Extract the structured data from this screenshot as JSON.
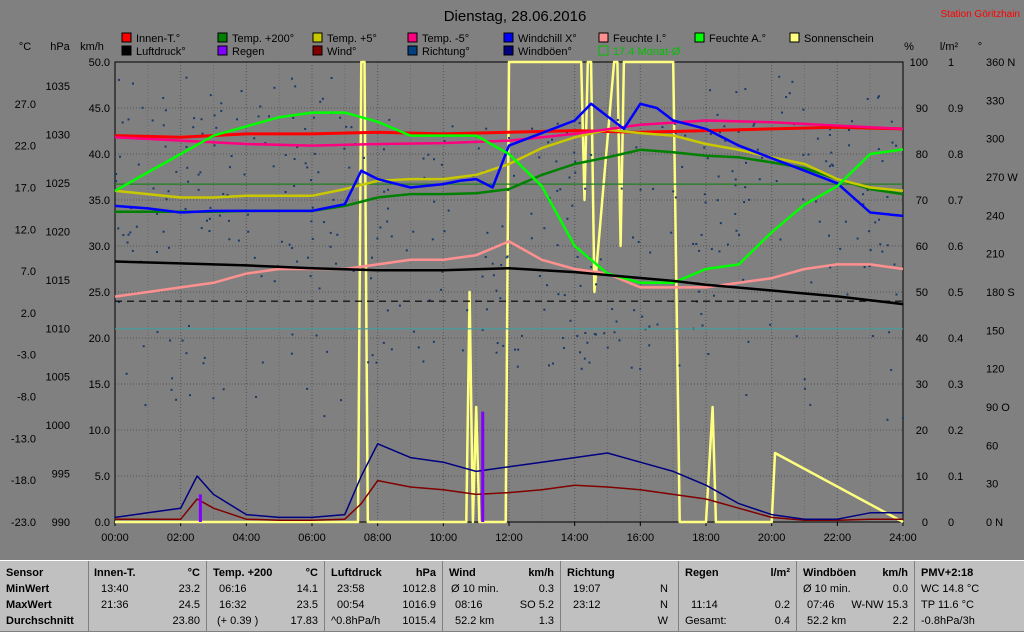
{
  "chart_data": {
    "type": "line",
    "title": "Dienstag, 28.06.2016",
    "station": "Station Göritzhain",
    "units_left": [
      "°C",
      "hPa",
      "km/h"
    ],
    "units_right": [
      "%",
      "l/m²",
      "°"
    ],
    "x_ticks": [
      "00:00",
      "02:00",
      "04:00",
      "06:00",
      "08:00",
      "10:00",
      "12:00",
      "14:00",
      "16:00",
      "18:00",
      "20:00",
      "22:00",
      "24:00"
    ],
    "y_temp_ticks": [
      "27.0",
      "22.0",
      "17.0",
      "12.0",
      "7.0",
      "2.0",
      "-3.0",
      "-8.0",
      "-13.0",
      "-18.0",
      "-23.0"
    ],
    "y_pressure_ticks": [
      "1035",
      "1030",
      "1025",
      "1020",
      "1015",
      "1010",
      "1005",
      "1000",
      "995",
      "990"
    ],
    "y_wind_ticks": [
      "50.0",
      "45.0",
      "40.0",
      "35.0",
      "30.0",
      "25.0",
      "20.0",
      "15.0",
      "10.0",
      "5.0",
      "0.0"
    ],
    "y_humidity_ticks": [
      "100",
      "90",
      "80",
      "70",
      "60",
      "50",
      "40",
      "30",
      "20",
      "10",
      "0"
    ],
    "y_rain_ticks": [
      "1",
      "0.9",
      "0.8",
      "0.7",
      "0.6",
      "0.5",
      "0.4",
      "0.3",
      "0.2",
      "0.1",
      "0"
    ],
    "y_dir_ticks": [
      "360 N",
      "330",
      "300",
      "270 W",
      "240",
      "210",
      "180 S",
      "150",
      "120",
      "90 O",
      "60",
      "30",
      "0 N"
    ],
    "legend": [
      {
        "label": "Innen-T.°",
        "color": "#ff0000"
      },
      {
        "label": "Temp. +200°",
        "color": "#008000"
      },
      {
        "label": "Temp. +5°",
        "color": "#c8c800"
      },
      {
        "label": "Temp. -5°",
        "color": "#ff0080"
      },
      {
        "label": "Windchill X°",
        "color": "#0000ff"
      },
      {
        "label": "Feuchte I.°",
        "color": "#ff9090"
      },
      {
        "label": "Feuchte A.°",
        "color": "#00ff00"
      },
      {
        "label": "Sonnenschein",
        "color": "#ffff80"
      },
      {
        "label": "Luftdruck°",
        "color": "#000000"
      },
      {
        "label": "Regen",
        "color": "#8000ff"
      },
      {
        "label": "Wind°",
        "color": "#800000"
      },
      {
        "label": "Richtung°",
        "color": "#004080"
      },
      {
        "label": "Windböen°",
        "color": "#000080"
      },
      {
        "label": "17.4 Monat-Ø",
        "color": "#00c000"
      }
    ],
    "series": [
      {
        "name": "Innen-T.°",
        "axis": "temp",
        "x": [
          0,
          2,
          4,
          6,
          8,
          10,
          12,
          14,
          16,
          18,
          20,
          22,
          24
        ],
        "values": [
          23.2,
          23.0,
          23.4,
          23.4,
          23.6,
          23.4,
          23.6,
          23.8,
          23.6,
          23.8,
          24.0,
          24.2,
          24.0
        ]
      },
      {
        "name": "Temp. +200°",
        "axis": "temp",
        "x": [
          0,
          1,
          2,
          3,
          4,
          5,
          6,
          7,
          8,
          9,
          10,
          11,
          12,
          13,
          14,
          15,
          16,
          17,
          18,
          19,
          20,
          21,
          22,
          23,
          24
        ],
        "values": [
          14.1,
          14.1,
          14.1,
          14.1,
          14.2,
          14.2,
          14.2,
          14.8,
          15.8,
          16.2,
          16.2,
          16.3,
          16.8,
          18.5,
          19.8,
          20.6,
          21.5,
          21.2,
          20.8,
          20.6,
          20.0,
          19.3,
          18.0,
          16.8,
          16.2
        ]
      },
      {
        "name": "Temp. +5°",
        "axis": "temp",
        "x": [
          0,
          1,
          2,
          3,
          4,
          5,
          6,
          7,
          8,
          9,
          10,
          11,
          12,
          13,
          14,
          15,
          16,
          17,
          18,
          19,
          20,
          21,
          22,
          23,
          24
        ],
        "values": [
          16.6,
          16.2,
          15.8,
          15.8,
          16.0,
          16.0,
          16.0,
          16.8,
          17.8,
          18.0,
          18.0,
          18.5,
          19.8,
          21.7,
          23.0,
          23.9,
          23.5,
          23.2,
          22.2,
          21.5,
          20.6,
          19.8,
          18.0,
          17.0,
          16.6
        ]
      },
      {
        "name": "Temp. -5°",
        "axis": "temp",
        "x": [
          0,
          2,
          4,
          6,
          8,
          10,
          12,
          14,
          16,
          18,
          20,
          22,
          24
        ],
        "values": [
          23.0,
          22.6,
          22.2,
          22.0,
          22.2,
          22.3,
          22.6,
          23.4,
          24.5,
          25.0,
          24.8,
          24.4,
          24.0
        ]
      },
      {
        "name": "Windchill X°",
        "axis": "temp",
        "x": [
          0,
          1,
          2,
          3,
          4,
          5,
          6,
          7,
          7.5,
          8,
          9,
          10,
          10.5,
          11,
          11.5,
          12,
          13,
          14,
          14.5,
          15,
          15.5,
          16,
          16.5,
          17,
          18,
          19,
          20,
          21,
          22,
          23,
          24
        ],
        "values": [
          14.8,
          14.5,
          14.0,
          14.2,
          14.2,
          14.2,
          14.2,
          15.0,
          19.0,
          18.0,
          17.0,
          17.4,
          17.8,
          18.0,
          17.0,
          22.0,
          23.5,
          25.0,
          27.0,
          25.5,
          24.0,
          27.0,
          26.5,
          25.0,
          24.0,
          22.0,
          20.5,
          19.0,
          17.5,
          14.0,
          13.6
        ]
      },
      {
        "name": "Feuchte I.°",
        "axis": "humidity",
        "x": [
          0,
          1,
          2,
          3,
          4,
          5,
          6,
          7,
          8,
          9,
          10,
          11,
          12,
          13,
          14,
          15,
          16,
          17,
          18,
          19,
          20,
          21,
          22,
          23,
          24
        ],
        "values": [
          49,
          50,
          51,
          52,
          54,
          55,
          55,
          55,
          56,
          57,
          57,
          58,
          61,
          57,
          55,
          54,
          51,
          51,
          51,
          52,
          53,
          55,
          56,
          56,
          55
        ]
      },
      {
        "name": "Feuchte A.°",
        "axis": "humidity",
        "x": [
          0,
          1,
          2,
          3,
          4,
          5,
          6,
          7,
          8,
          9,
          10,
          11,
          12,
          13,
          14,
          15,
          16,
          17,
          18,
          19,
          20,
          21,
          22,
          23,
          24
        ],
        "values": [
          72,
          76,
          80,
          84,
          86,
          88,
          89,
          89,
          87,
          84,
          84,
          84,
          80,
          73,
          60,
          54,
          52,
          52,
          55,
          56,
          63,
          69,
          73,
          80,
          81
        ]
      },
      {
        "name": "Luftdruck°",
        "axis": "pressure",
        "x": [
          0,
          2,
          4,
          6,
          8,
          10,
          12,
          14,
          16,
          17,
          18,
          19,
          20,
          21,
          22,
          23,
          24
        ],
        "values": [
          1016.9,
          1016.7,
          1016.5,
          1016.2,
          1016.0,
          1016.0,
          1016.2,
          1015.8,
          1015.2,
          1014.9,
          1014.5,
          1014.2,
          1013.9,
          1013.6,
          1013.3,
          1012.9,
          1012.5
        ]
      },
      {
        "name": "Wind°",
        "axis": "wind",
        "x": [
          0,
          1,
          2,
          2.5,
          3,
          4,
          5,
          6,
          7,
          7.5,
          8,
          9,
          10,
          11,
          12,
          13,
          14,
          15,
          16,
          17,
          18,
          19,
          20,
          21,
          22,
          23,
          24
        ],
        "values": [
          0.3,
          0.3,
          0.3,
          2.5,
          1.5,
          0.3,
          0.2,
          0.2,
          0.3,
          2.0,
          4.5,
          3.8,
          3.5,
          3.0,
          3.2,
          3.5,
          4.0,
          3.8,
          3.5,
          3.0,
          2.5,
          1.5,
          0.5,
          0.2,
          0.2,
          0.3,
          0.3
        ]
      },
      {
        "name": "Windböen°",
        "axis": "wind",
        "x": [
          0,
          1,
          2,
          2.5,
          3,
          4,
          5,
          6,
          7,
          7.5,
          8,
          9,
          10,
          11,
          12,
          13,
          14,
          15,
          16,
          17,
          18,
          19,
          20,
          21,
          22,
          23,
          24
        ],
        "values": [
          0.5,
          1.0,
          1.5,
          5.0,
          3.0,
          0.8,
          0.5,
          0.5,
          0.8,
          5.0,
          8.5,
          7.0,
          6.5,
          5.5,
          6.0,
          6.5,
          7.0,
          7.5,
          6.5,
          5.5,
          4.0,
          2.0,
          0.8,
          0.3,
          0.3,
          1.0,
          1.0
        ]
      },
      {
        "name": "Sonnenschein",
        "axis": "sun",
        "x": [
          0,
          7.4,
          7.5,
          7.6,
          7.7,
          8.0,
          8.1,
          10.7,
          10.8,
          10.9,
          11.0,
          11.1,
          11.9,
          12.0,
          14.2,
          14.3,
          14.4,
          14.5,
          14.6,
          15.2,
          15.3,
          15.4,
          15.5,
          15.6,
          16.0,
          16.5,
          17.0,
          17.2,
          17.3,
          18.0,
          18.2,
          18.3,
          20.0,
          20.1,
          24
        ],
        "values": [
          0,
          0,
          1,
          1,
          0,
          0,
          0,
          0,
          0.5,
          0,
          0.25,
          0,
          0,
          1,
          1,
          0.7,
          1,
          1,
          0.5,
          1,
          1,
          0.6,
          1,
          1,
          1,
          1,
          1,
          0,
          0,
          0,
          0.25,
          0,
          0,
          0.15,
          0
        ]
      },
      {
        "name": "Regen",
        "axis": "rain",
        "x": [
          2.6,
          11.2
        ],
        "values": [
          0.06,
          0.24
        ]
      }
    ],
    "reference_lines": [
      {
        "name": "Luftdruck-Mittel",
        "axis": "pressure",
        "value": 1012.8,
        "style": "dashed",
        "color": "#000000"
      },
      {
        "name": "17.4 Monat-Ø",
        "axis": "temp",
        "value": 17.4,
        "style": "solid",
        "color": "#208020"
      },
      {
        "name": "Feuchte-Referenz",
        "axis": "humidity",
        "value": 42,
        "style": "solid",
        "color": "#40a0a0"
      }
    ],
    "ranges": {
      "x": [
        0,
        24
      ],
      "temp": [
        -23,
        32
      ],
      "pressure": [
        990,
        1037.5
      ],
      "wind": [
        0,
        50
      ],
      "humidity": [
        0,
        100
      ],
      "rain": [
        0,
        1
      ],
      "dir": [
        0,
        360
      ]
    },
    "grid": true
  },
  "stats": {
    "row_labels": [
      "Sensor",
      "MinWert",
      "MaxWert",
      "Durchschnitt"
    ],
    "innen": {
      "header": "Innen-T.",
      "unit": "°C",
      "min_time": "13:40",
      "min": "23.2",
      "max_time": "21:36",
      "max": "24.5",
      "avg": "23.80"
    },
    "temp200": {
      "header": "Temp. +200",
      "unit": "°C",
      "min_time": "06:16",
      "min": "14.1",
      "max_time": "16:32",
      "max": "23.5",
      "avg_note": "(+ 0.39 )",
      "avg": "17.83"
    },
    "luftdruck": {
      "header": "Luftdruck",
      "unit": "hPa",
      "min_time": "23:58",
      "min": "1012.8",
      "max_time": "00:54",
      "max": "1016.9",
      "avg_note": "^0.8hPa/h",
      "avg": "1015.4"
    },
    "wind": {
      "header": "Wind",
      "unit": "km/h",
      "r1_label": "Ø 10 min.",
      "r1_val": "0.3",
      "r2_label": "08:16",
      "r2_val": "SO 5.2",
      "r3_label": "52.2 km",
      "r3_val": "1.3"
    },
    "richtung": {
      "header": "Richtung",
      "r1_label": "19:07",
      "r1_val": "N",
      "r2_label": "23:12",
      "r2_val": "N",
      "r3_val": "W"
    },
    "regen": {
      "header": "Regen",
      "unit": "l/m²",
      "r2_label": "11:14",
      "r2_val": "0.2",
      "r3_label": "Gesamt:",
      "r3_val": "0.4"
    },
    "boeen": {
      "header": "Windböen",
      "unit": "km/h",
      "r1_label": "Ø 10 min.",
      "r1_val": "0.0",
      "r2_label": "07:46",
      "r2_val": "W-NW 15.3",
      "r3_label": "52.2 km",
      "r3_val": "2.2"
    },
    "pmv": {
      "header": "PMV+2:18",
      "r1": "WC 14.8 °C",
      "r2": "TP 11.6 °C",
      "r3": "-0.8hPa/3h"
    }
  }
}
